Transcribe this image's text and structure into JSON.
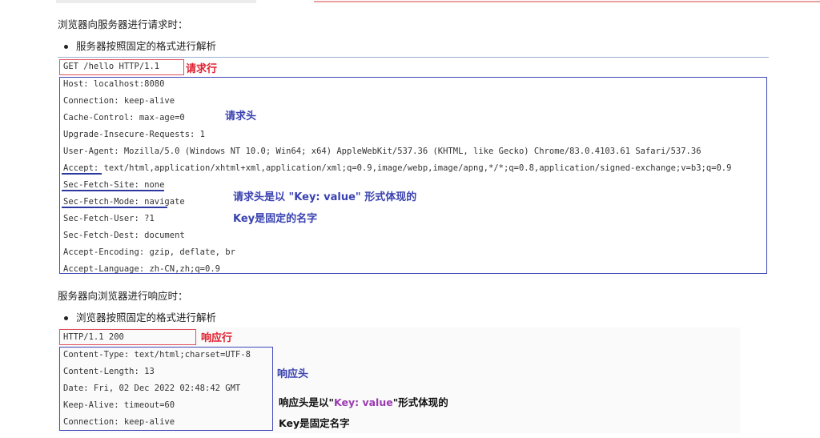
{
  "request_section": {
    "heading": "浏览器向服务器进行请求时：",
    "bullet": "服务器按照固定的格式进行解析",
    "request_line": "GET /hello HTTP/1.1",
    "headers": [
      "Host: localhost:8080",
      "Connection: keep-alive",
      "Cache-Control: max-age=0",
      "Upgrade-Insecure-Requests: 1",
      "User-Agent: Mozilla/5.0 (Windows NT 10.0; Win64; x64) AppleWebKit/537.36 (KHTML, like Gecko) Chrome/83.0.4103.61 Safari/537.36",
      "Accept: text/html,application/xhtml+xml,application/xml;q=0.9,image/webp,image/apng,*/*;q=0.8,application/signed-exchange;v=b3;q=0.9",
      "Sec-Fetch-Site: none",
      "Sec-Fetch-Mode: navigate",
      "Sec-Fetch-User: ?1",
      "Sec-Fetch-Dest: document",
      "Accept-Encoding: gzip, deflate, br",
      "Accept-Language: zh-CN,zh;q=0.9"
    ],
    "annotations": {
      "request_line_label": "请求行",
      "headers_label": "请求头",
      "format_note": "请求头是以 \"Key: value\" 形式体现的",
      "key_note": "Key是固定的名字"
    }
  },
  "response_section": {
    "heading": "服务器向浏览器进行响应时：",
    "bullet": "浏览器按照固定的格式进行解析",
    "status_line": "HTTP/1.1 200",
    "headers": [
      "Content-Type: text/html;charset=UTF-8",
      "Content-Length: 13",
      "Date: Fri, 02 Dec 2022 02:48:42 GMT",
      "Keep-Alive: timeout=60",
      "Connection: keep-alive"
    ],
    "annotations": {
      "status_line_label": "响应行",
      "headers_label": "响应头",
      "format_note_pre": "响应头是以\"",
      "format_note_key": "Key: value",
      "format_note_post": "\"形式体现的",
      "key_note": "Key是固定名字"
    }
  },
  "colors": {
    "red_annotation": "#e02030",
    "blue_annotation": "#3a42b0",
    "purple_highlight": "#9a3ab0"
  }
}
